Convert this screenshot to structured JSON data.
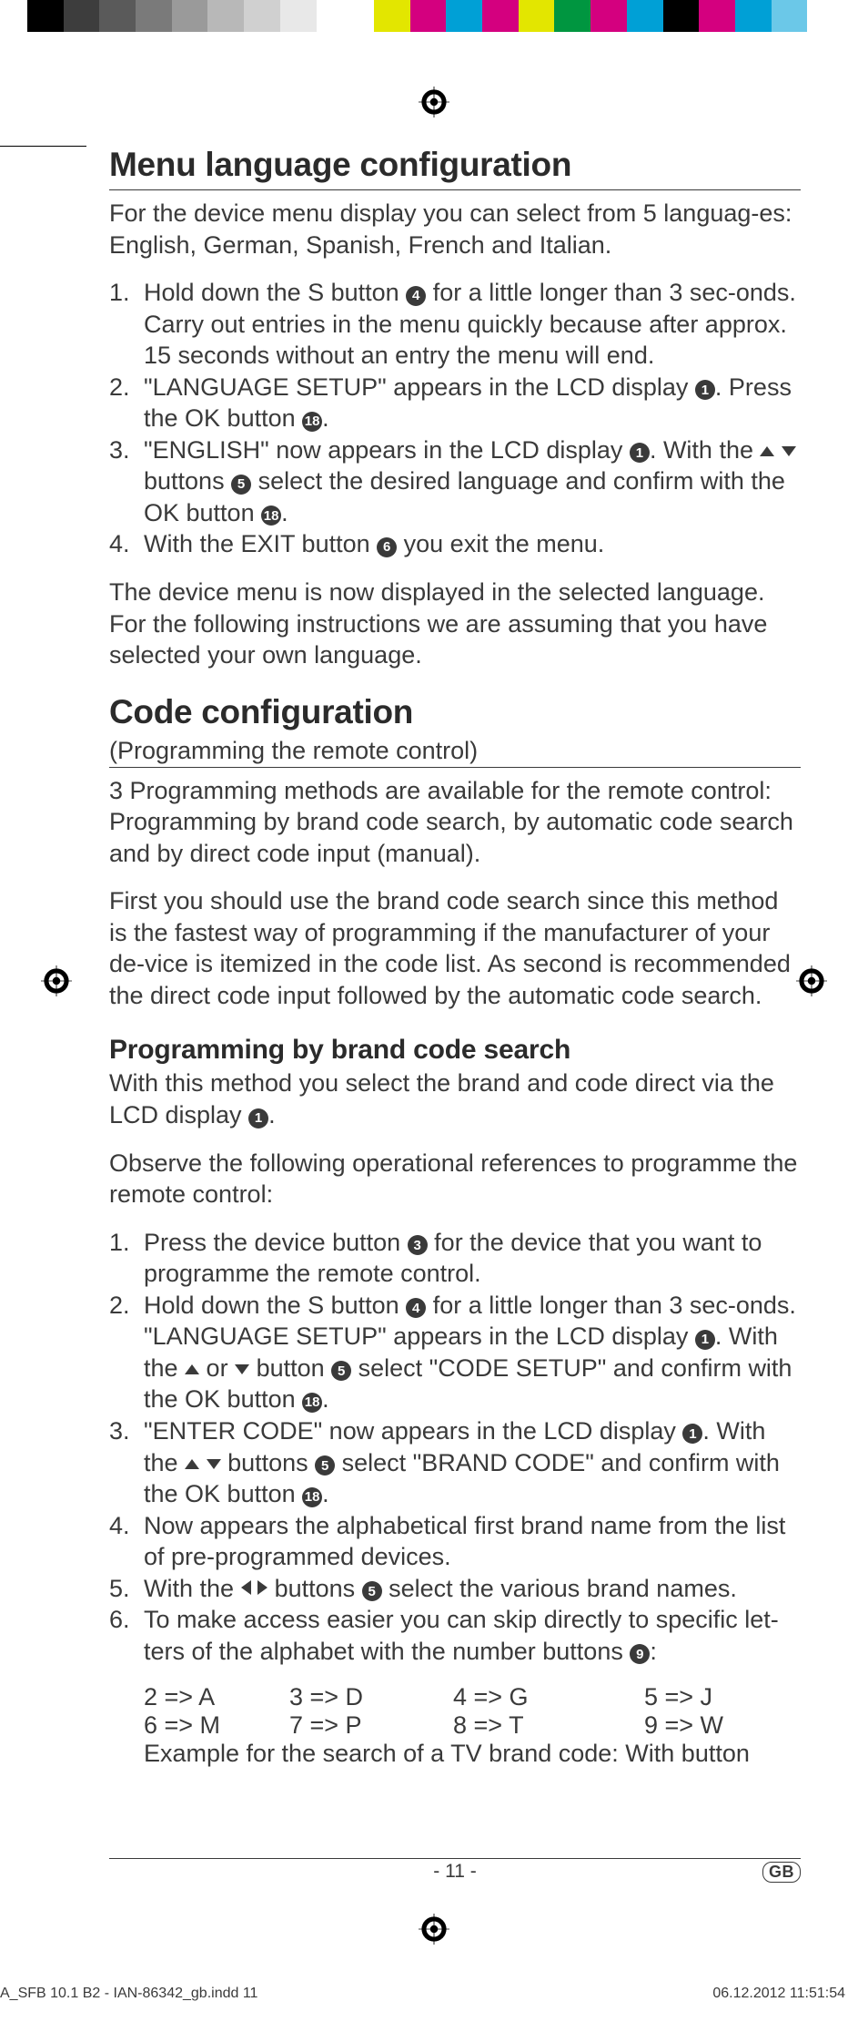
{
  "colorbar": [
    "#000000",
    "#3d3d3d",
    "#5a5a5a",
    "#7a7a7a",
    "#9a9a9a",
    "#b8b8b8",
    "#d0d0d0",
    "#e8e8e8",
    "#ffffff",
    "gap",
    "#e3e600",
    "#d4007f",
    "#00a0d6",
    "#d4007f",
    "#e3e600",
    "#009640",
    "#d4007f",
    "#00a0d6",
    "#000000",
    "#d4007f",
    "#00a0d6",
    "#6bc8e8",
    "#ffffff"
  ],
  "section1": {
    "title": "Menu language conﬁguration",
    "intro": "For the device menu display you can select from 5 languag-es: English, German, Spanish, French and Italian.",
    "steps": [
      {
        "n": "1.",
        "pre": "Hold down the S button ",
        "c": "4",
        "post": " for a little longer than 3 sec-onds. Carry out entries in the menu quickly because after approx. 15 seconds without an entry the menu will end."
      },
      {
        "n": "2.",
        "pre": "\"LANGUAGE SETUP\" appears in the LCD display ",
        "c": "1",
        "post": ". Press the OK button ",
        "c2": "18",
        "post2": "."
      },
      {
        "n": "3.",
        "pre": "\"ENGLISH\" now appears in the LCD display ",
        "c": "1",
        "mid": ". With the ",
        "arrows": "ud",
        "mid2": " buttons ",
        "c2": "5",
        "mid3": " select the desired language and conﬁrm with the OK button ",
        "c3": "18",
        "post": "."
      },
      {
        "n": "4.",
        "pre": "With the EXIT button ",
        "c": "6",
        "post": " you exit the menu."
      }
    ],
    "outro": "The device menu is now displayed in the selected language. For the following instructions we are assuming that you have selected your own language."
  },
  "section2": {
    "title": "Code conﬁguration",
    "subtitle": "(Programming the remote control)",
    "p1": "3 Programming methods are available for the remote control: Programming by brand code search, by automatic code search and by direct code input (manual).",
    "p2": "First you should use the brand code search since this method is the fastest way of programming if the manufacturer of your de-vice is itemized in the code list. As second is recommended the direct code input followed by the automatic code search."
  },
  "section3": {
    "title": "Programming by brand code search",
    "intro_pre": "With this method you select the brand and code direct via the LCD display ",
    "intro_c": "1",
    "intro_post": ".",
    "observe": "Observe the following operational references to programme the remote control:",
    "steps": [
      {
        "n": "1.",
        "pre": "Press the device button ",
        "c": "3",
        "post": " for the device that you want to programme the remote control."
      },
      {
        "n": "2.",
        "pre": "Hold down the S button ",
        "c": "4",
        "mid": " for a little longer than 3 sec-onds. \"LANGUAGE SETUP\" appears in the LCD display ",
        "c2": "1",
        "mid2": ". With the ",
        "arrows": "ud_or",
        "mid3": " button ",
        "c3": "5",
        "mid4": " select \"CODE SETUP\" and conﬁrm with the OK button ",
        "c4": "18",
        "post": "."
      },
      {
        "n": "3.",
        "pre": "\"ENTER CODE\" now appears in the LCD display ",
        "c": "1",
        "mid": ". With the ",
        "arrows": "ud",
        "mid2": " buttons ",
        "c2": "5",
        "mid3": " select \"BRAND CODE\" and conﬁrm with the OK button ",
        "c3": "18",
        "post": "."
      },
      {
        "n": "4.",
        "txt": "Now appears the alphabetical ﬁrst brand name from the list of pre-programmed devices."
      },
      {
        "n": "5.",
        "pre": "With the ",
        "arrows": "lr",
        "mid": " buttons ",
        "c": "5",
        "post": " select the various brand names."
      },
      {
        "n": "6.",
        "pre": "To make access easier you can skip directly to speciﬁc let-ters of the alphabet with the number buttons ",
        "c": "9",
        "post": ":"
      }
    ],
    "map": [
      [
        "2 => A",
        "3 => D",
        "4 => G",
        "5 => J"
      ],
      [
        "6 => M",
        "7 => P",
        "8 => T",
        "9 => W"
      ]
    ],
    "example": "Example for the search of a TV brand code: With button"
  },
  "footer": {
    "page": "- 11 -",
    "gb": "GB"
  },
  "imprint": {
    "left": "A_SFB 10.1 B2 - IAN-86342_gb.indd   11",
    "right": "06.12.2012   11:51:54"
  }
}
